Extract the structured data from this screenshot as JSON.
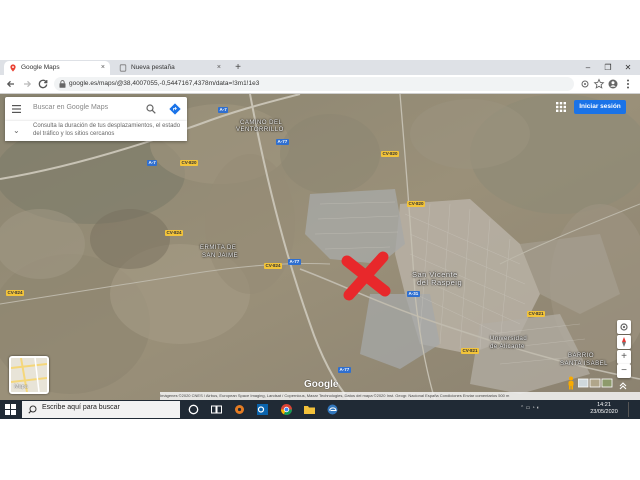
{
  "browser": {
    "tabs": [
      {
        "label": "Google Maps",
        "active": true
      },
      {
        "label": "Nueva pestaña",
        "active": false
      }
    ],
    "close_symbol": "×",
    "new_tab_symbol": "+",
    "window_controls": {
      "minimize": "–",
      "maximize": "❐",
      "close": "✕"
    },
    "url": "google.es/maps/@38,4007055,-0,5447167,4378m/data=!3m1!1e3",
    "nav": {
      "back_icon": "arrow-left-icon",
      "forward_icon": "arrow-right-icon",
      "reload_icon": "reload-icon"
    }
  },
  "maps": {
    "search_placeholder": "Buscar en Google Maps",
    "duration_hint": "Consulta la duración de tus desplazamientos, el estado del tráfico y los sitios cercanos",
    "sign_in_label": "Iniciar sesión",
    "minimap_label": "Mapa",
    "logo": "Google",
    "attribution": "Imágenes ©2020 CNES / Airbus, European Space Imaging, Landsat / Copernicus, Maxar Technologies, Datos del mapa ©2020 Inst. Geogr. Nacional   España   Condiciones   Enviar comentarios   500 m",
    "zoom_in": "+",
    "zoom_out": "−",
    "marker_color": "#e8282b",
    "place_labels": [
      {
        "text": "CAMINO DEL",
        "id": "camino-del"
      },
      {
        "text": "VENTORRILLO",
        "id": "ventorrillo"
      },
      {
        "text": "ERMITA DE",
        "id": "ermita-de"
      },
      {
        "text": "SAN JAIME",
        "id": "san-jaime"
      },
      {
        "text": "San Vicente",
        "id": "san-vicente"
      },
      {
        "text": "del Raspeig",
        "id": "del-raspeig"
      },
      {
        "text": "BARRIO",
        "id": "barrio"
      },
      {
        "text": "SANTA ISABEL",
        "id": "santa-isabel"
      },
      {
        "text": "Universidad",
        "id": "universidad"
      },
      {
        "text": "de Alicante",
        "id": "de-alicante"
      }
    ],
    "road_labels": [
      {
        "text": "A-7",
        "color": "blue"
      },
      {
        "text": "A-77",
        "color": "blue"
      },
      {
        "text": "A-31",
        "color": "blue"
      },
      {
        "text": "CV-820",
        "color": "yellow"
      },
      {
        "text": "CV-824",
        "color": "yellow"
      },
      {
        "text": "CV-821",
        "color": "yellow"
      }
    ]
  },
  "taskbar": {
    "search_placeholder": "Escribe aquí para buscar",
    "time": "14:21",
    "date": "23/05/2020"
  }
}
